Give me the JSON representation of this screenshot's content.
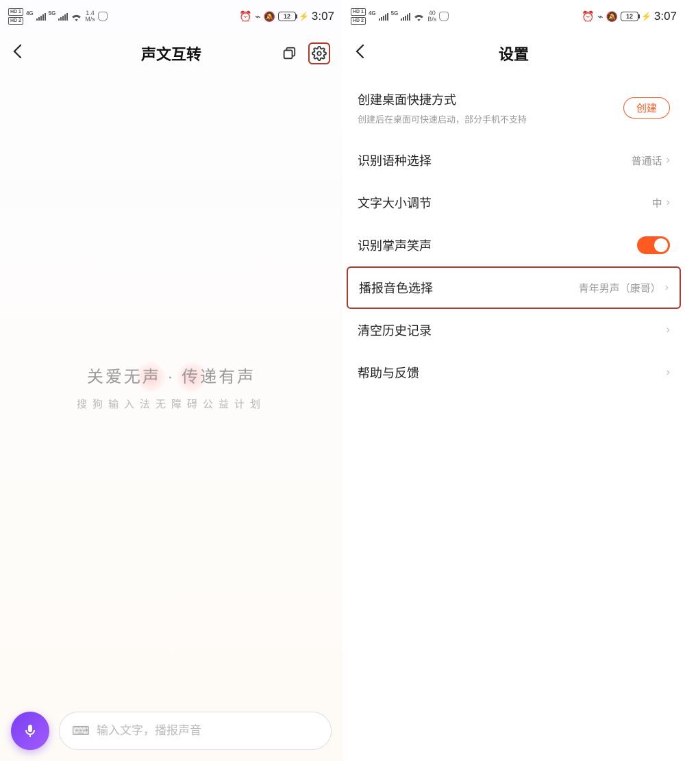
{
  "status": {
    "hd1": "HD 1",
    "hd2": "HD 2",
    "net1": "4G",
    "net2": "5G",
    "rate_left_top": "1.4",
    "rate_left_bot": "M/s",
    "rate_right_top": "40",
    "rate_right_bot": "B/s",
    "battery": "12",
    "time": "3:07"
  },
  "left": {
    "title": "声文互转",
    "promo_main": "关爱无声 · 传递有声",
    "promo_sub": "搜狗输入法无障碍公益计划",
    "input_placeholder": "输入文字，播报声音"
  },
  "right": {
    "title": "设置",
    "shortcut_label": "创建桌面快捷方式",
    "shortcut_sub": "创建后在桌面可快速启动，部分手机不支持",
    "shortcut_btn": "创建",
    "lang_label": "识别语种选择",
    "lang_value": "普通话",
    "font_label": "文字大小调节",
    "font_value": "中",
    "applause_label": "识别掌声笑声",
    "voice_label": "播报音色选择",
    "voice_value": "青年男声（康哥）",
    "clear_label": "清空历史记录",
    "help_label": "帮助与反馈"
  }
}
